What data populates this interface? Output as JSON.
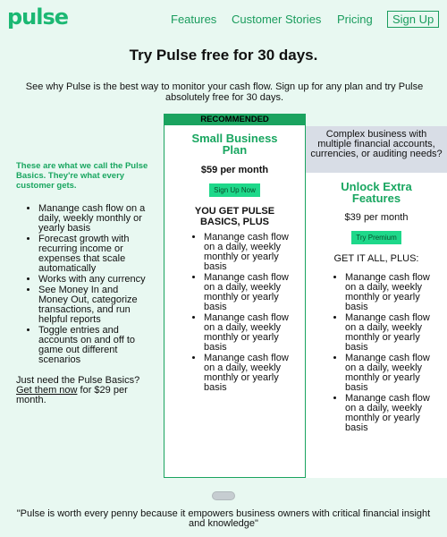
{
  "nav": {
    "logo": "pulse",
    "links": [
      "Features",
      "Customer Stories",
      "Pricing"
    ],
    "signup": "Sign Up"
  },
  "headline": "Try Pulse free for 30 days.",
  "subline": "See why Pulse is the best way to monitor your cash flow. Sign up for any plan and try Pulse absolutely free for 30 days.",
  "left": {
    "intro": "These are what we call the Pulse Basics. They're what every customer gets.",
    "features": [
      "Manange cash flow on a daily, weekly monthly or yearly basis",
      "Forecast growth with recurring income or expenses that scale automatically",
      "Works with any currency",
      "See Money In and Money Out, categorize transactions, and run helpful reports",
      "Toggle entries and accounts on and off to game out different scenarios"
    ],
    "just_prefix": "Just need the Pulse Basics?",
    "just_link": "Get them now",
    "just_suffix": " for $29 per month."
  },
  "small_plan": {
    "badge": "RECOMMENDED",
    "title": "Small Business Plan",
    "price": "$59 per month",
    "button": "Sign Up Now",
    "heading": "YOU GET PULSE BASICS, PLUS",
    "items": [
      "Manange cash flow on a daily, weekly monthly or yearly basis",
      "Manange cash flow on a daily, weekly monthly or yearly basis",
      "Manange cash flow on a daily, weekly monthly or yearly basis",
      "Manange cash flow on a daily, weekly monthly or yearly basis"
    ]
  },
  "extra_plan": {
    "note": "Complex business with multiple financial accounts, currencies, or auditing needs?",
    "title": "Unlock Extra Features",
    "price": "$39 per month",
    "button": "Try Premium",
    "heading": "GET IT ALL, PLUS:",
    "items": [
      "Manange cash flow on a daily, weekly monthly or yearly basis",
      "Manange cash flow on a daily, weekly monthly or yearly basis",
      "Manange cash flow on a daily, weekly monthly or yearly basis",
      "Manange cash flow on a daily, weekly monthly or yearly basis"
    ]
  },
  "quote": "\"Pulse is worth every penny because it empowers business owners with critical financial insight and knowledge\""
}
